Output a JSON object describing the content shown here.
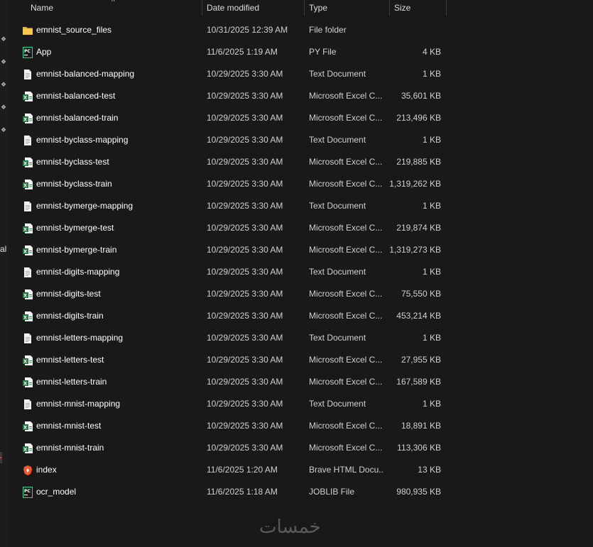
{
  "columns": {
    "name": "Name",
    "date": "Date modified",
    "type": "Type",
    "size": "Size"
  },
  "nav": {
    "cut_label": "al"
  },
  "files": [
    {
      "name": "emnist_source_files",
      "date": "10/31/2025 12:39 AM",
      "type": "File folder",
      "size": "",
      "icon": "folder-icon"
    },
    {
      "name": "App",
      "date": "11/6/2025 1:19 AM",
      "type": "PY File",
      "size": "4 KB",
      "icon": "pycharm-file-icon"
    },
    {
      "name": "emnist-balanced-mapping",
      "date": "10/29/2025 3:30 AM",
      "type": "Text Document",
      "size": "1 KB",
      "icon": "text-document-icon"
    },
    {
      "name": "emnist-balanced-test",
      "date": "10/29/2025 3:30 AM",
      "type": "Microsoft Excel C...",
      "size": "35,601 KB",
      "icon": "excel-csv-icon"
    },
    {
      "name": "emnist-balanced-train",
      "date": "10/29/2025 3:30 AM",
      "type": "Microsoft Excel C...",
      "size": "213,496 KB",
      "icon": "excel-csv-icon"
    },
    {
      "name": "emnist-byclass-mapping",
      "date": "10/29/2025 3:30 AM",
      "type": "Text Document",
      "size": "1 KB",
      "icon": "text-document-icon"
    },
    {
      "name": "emnist-byclass-test",
      "date": "10/29/2025 3:30 AM",
      "type": "Microsoft Excel C...",
      "size": "219,885 KB",
      "icon": "excel-csv-icon"
    },
    {
      "name": "emnist-byclass-train",
      "date": "10/29/2025 3:30 AM",
      "type": "Microsoft Excel C...",
      "size": "1,319,262 KB",
      "icon": "excel-csv-icon"
    },
    {
      "name": "emnist-bymerge-mapping",
      "date": "10/29/2025 3:30 AM",
      "type": "Text Document",
      "size": "1 KB",
      "icon": "text-document-icon"
    },
    {
      "name": "emnist-bymerge-test",
      "date": "10/29/2025 3:30 AM",
      "type": "Microsoft Excel C...",
      "size": "219,874 KB",
      "icon": "excel-csv-icon"
    },
    {
      "name": "emnist-bymerge-train",
      "date": "10/29/2025 3:30 AM",
      "type": "Microsoft Excel C...",
      "size": "1,319,273 KB",
      "icon": "excel-csv-icon"
    },
    {
      "name": "emnist-digits-mapping",
      "date": "10/29/2025 3:30 AM",
      "type": "Text Document",
      "size": "1 KB",
      "icon": "text-document-icon"
    },
    {
      "name": "emnist-digits-test",
      "date": "10/29/2025 3:30 AM",
      "type": "Microsoft Excel C...",
      "size": "75,550 KB",
      "icon": "excel-csv-icon"
    },
    {
      "name": "emnist-digits-train",
      "date": "10/29/2025 3:30 AM",
      "type": "Microsoft Excel C...",
      "size": "453,214 KB",
      "icon": "excel-csv-icon"
    },
    {
      "name": "emnist-letters-mapping",
      "date": "10/29/2025 3:30 AM",
      "type": "Text Document",
      "size": "1 KB",
      "icon": "text-document-icon"
    },
    {
      "name": "emnist-letters-test",
      "date": "10/29/2025 3:30 AM",
      "type": "Microsoft Excel C...",
      "size": "27,955 KB",
      "icon": "excel-csv-icon"
    },
    {
      "name": "emnist-letters-train",
      "date": "10/29/2025 3:30 AM",
      "type": "Microsoft Excel C...",
      "size": "167,589 KB",
      "icon": "excel-csv-icon"
    },
    {
      "name": "emnist-mnist-mapping",
      "date": "10/29/2025 3:30 AM",
      "type": "Text Document",
      "size": "1 KB",
      "icon": "text-document-icon"
    },
    {
      "name": "emnist-mnist-test",
      "date": "10/29/2025 3:30 AM",
      "type": "Microsoft Excel C...",
      "size": "18,891 KB",
      "icon": "excel-csv-icon"
    },
    {
      "name": "emnist-mnist-train",
      "date": "10/29/2025 3:30 AM",
      "type": "Microsoft Excel C...",
      "size": "113,306 KB",
      "icon": "excel-csv-icon"
    },
    {
      "name": "index",
      "date": "11/6/2025 1:20 AM",
      "type": "Brave HTML Docu...",
      "size": "13 KB",
      "icon": "brave-html-icon"
    },
    {
      "name": "ocr_model",
      "date": "11/6/2025 1:18 AM",
      "type": "JOBLIB File",
      "size": "980,935 KB",
      "icon": "pycharm-file-icon"
    }
  ],
  "watermark": {
    "text": "خمسات"
  },
  "colors": {
    "background": "#191919",
    "folder": "#e8b73c",
    "excel": "#1f7a45",
    "pycharm": "#21d789",
    "brave": "#fb542b"
  }
}
